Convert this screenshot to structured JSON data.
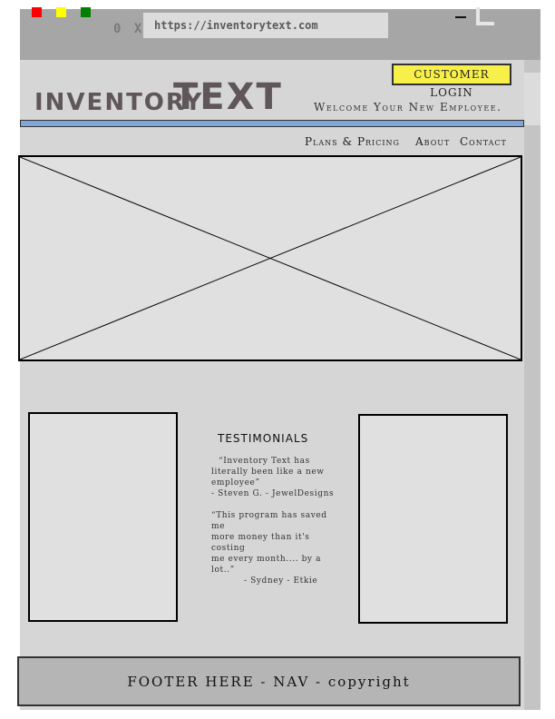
{
  "browser": {
    "window_controls": [
      "#ff0000",
      "#ffff00",
      "#008000"
    ],
    "nav_controls": "0 X",
    "url": "https://inventorytext.com"
  },
  "header": {
    "login_button": "CUSTOMER LOGIN",
    "logo_part1": "INVENTORY",
    "logo_part2": "TEXT",
    "tagline": "Welcome Your New Employee.",
    "accent_color": "#7fa6d6"
  },
  "nav": {
    "items": [
      {
        "label": "Plans & Pricing"
      },
      {
        "label": "About"
      },
      {
        "label": "Contact"
      }
    ]
  },
  "testimonials": {
    "title": "TESTIMONIALS",
    "quote1": {
      "lines": [
        "“Inventory Text has",
        "literally been like a new",
        "employee”",
        " - Steven G. - JewelDesigns"
      ]
    },
    "quote2": {
      "lines": [
        "“This program has saved",
        "me",
        "more money than it's",
        "costing",
        "me every month.... by a",
        "lot..”",
        "       - Sydney - Etkie"
      ]
    }
  },
  "footer": {
    "text": "FOOTER HERE - NAV - copyright"
  }
}
